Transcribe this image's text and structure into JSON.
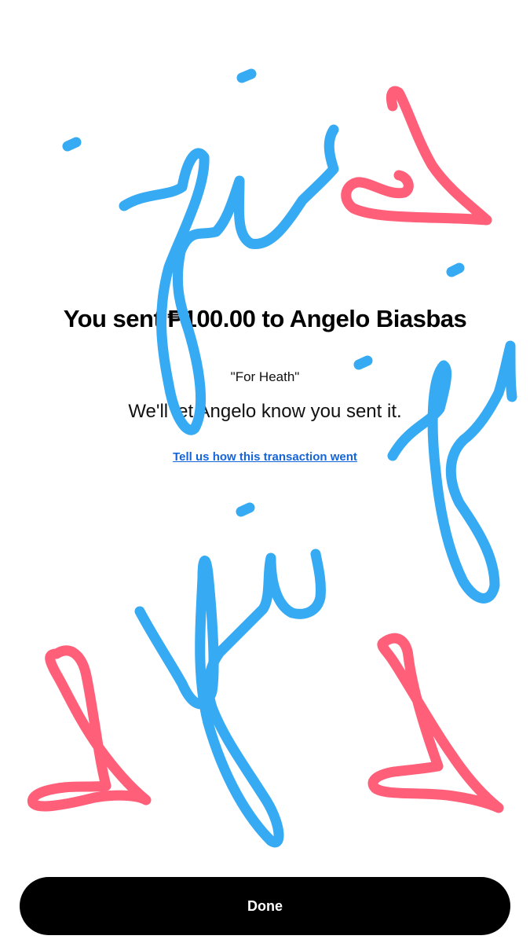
{
  "confirmation": {
    "title": "You sent ₱100.00 to Angelo Biasbas",
    "note": "\"For Heath\"",
    "message": "We'll let Angelo know you sent it.",
    "feedback_link": "Tell us how this transaction went"
  },
  "actions": {
    "done_label": "Done"
  },
  "colors": {
    "doodle_blue": "#36aaf2",
    "doodle_pink": "#ff5f78",
    "link_blue": "#1565d8",
    "button_bg": "#000000"
  }
}
